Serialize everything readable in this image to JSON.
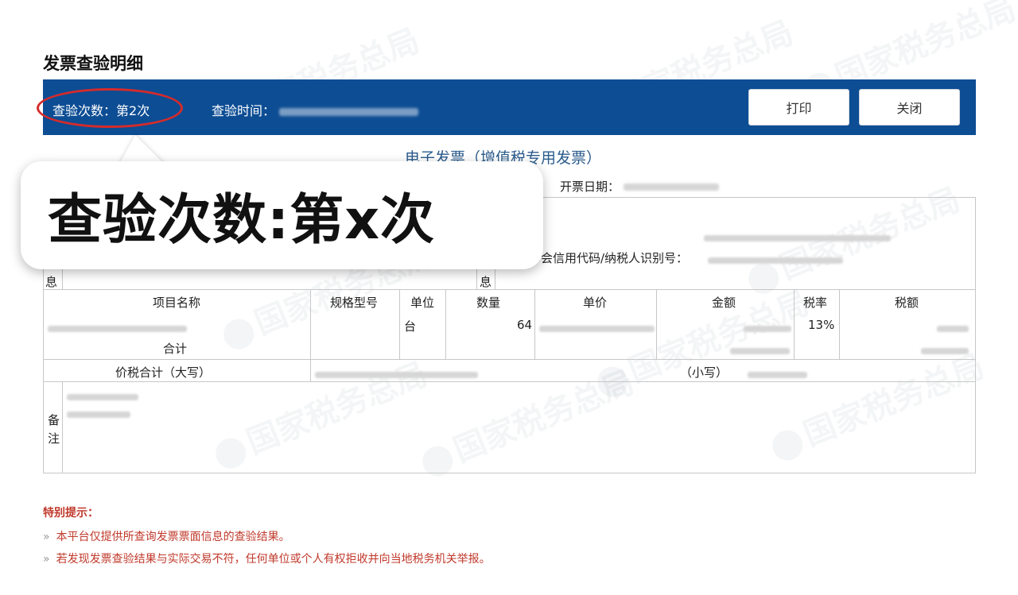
{
  "page": {
    "title": "发票查验明细"
  },
  "toolbar": {
    "count_label": "查验次数：第",
    "count_value": "2",
    "count_suffix": "次",
    "time_label": "查验时间：",
    "print_label": "打印",
    "close_label": "关闭"
  },
  "invoice": {
    "title": "电子发票（增值税专用发票）",
    "open_date_label": "开票日期：",
    "credit_code_label": "会信用代码/纳税人识别号：",
    "info_char_left": "息",
    "info_char_right": "息",
    "headers": [
      "项目名称",
      "规格型号",
      "单位",
      "数量",
      "单价",
      "金额",
      "税率",
      "税额"
    ],
    "row": {
      "unit": "台",
      "quantity": "64",
      "tax_rate": "13%"
    },
    "subtotal_label": "合计",
    "total_label": "价税合计（大写）",
    "small_label": "（小写）",
    "remarks_label_1": "备",
    "remarks_label_2": "注"
  },
  "tips": {
    "title": "特别提示：",
    "items": [
      "本平台仅提供所查询发票票面信息的查验结果。",
      "若发现发票查验结果与实际交易不符，任何单位或个人有权拒收并向当地税务机关举报。"
    ]
  },
  "callout": {
    "text": "查验次数:第x次"
  },
  "watermark": {
    "text": "国家税务总局"
  },
  "colors": {
    "bar": "#0d4d94",
    "accent_red": "#d52b2b",
    "tip_red": "#c0392b",
    "title_blue": "#2a5b8c"
  }
}
